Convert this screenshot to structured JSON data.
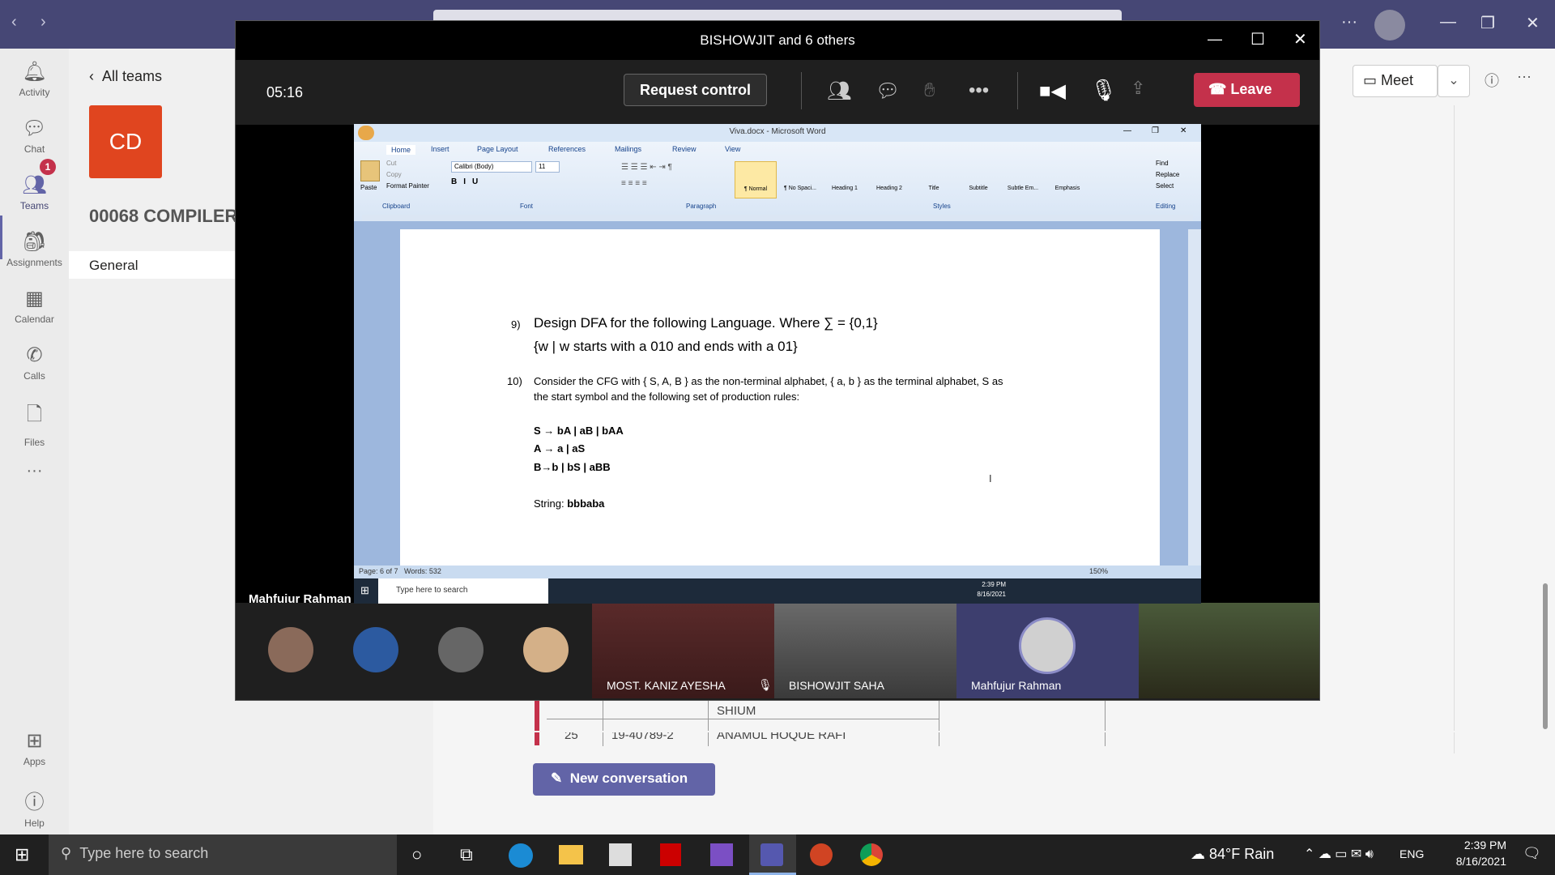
{
  "meeting": {
    "title": "BISHOWJIT and 6 others",
    "timer": "05:16",
    "request_control": "Request control",
    "leave": "Leave",
    "presenter_label": "Mahfujur Rahman",
    "participants": [
      {
        "name": "MOST. KANIZ AYESHA",
        "muted": true
      },
      {
        "name": "BISHOWJIT SAHA"
      },
      {
        "name": "Mahfujur Rahman"
      }
    ]
  },
  "teams": {
    "rail": [
      {
        "label": "Activity",
        "icon": "bell-icon"
      },
      {
        "label": "Chat",
        "icon": "chat-icon",
        "badge": "1"
      },
      {
        "label": "Teams",
        "icon": "teams-icon"
      },
      {
        "label": "Assignments",
        "icon": "assignments-icon"
      },
      {
        "label": "Calendar",
        "icon": "calendar-icon"
      },
      {
        "label": "Calls",
        "icon": "phone-icon"
      },
      {
        "label": "Files",
        "icon": "file-icon"
      },
      {
        "label": "Apps",
        "icon": "apps-icon"
      },
      {
        "label": "Help",
        "icon": "help-icon"
      }
    ],
    "all_teams": "All teams",
    "team_avatar": "CD",
    "team_name": "00068 COMPILER",
    "channel": "General",
    "meet_button": "Meet",
    "new_conversation": "New conversation",
    "table_rows": [
      "SHIUM",
      "25",
      "19-40789-2",
      "ANAMUL HOQUE RAFI"
    ]
  },
  "word": {
    "title": "Viva.docx - Microsoft Word",
    "tabs": [
      "Home",
      "Insert",
      "Page Layout",
      "References",
      "Mailings",
      "Review",
      "View"
    ],
    "font": "Calibri (Body)",
    "font_size": "11",
    "styles": [
      "¶ Normal",
      "¶ No Spaci...",
      "Heading 1",
      "Heading 2",
      "Title",
      "Subtitle",
      "Subtle Em...",
      "Emphasis"
    ],
    "groups": [
      "Clipboard",
      "Font",
      "Paragraph",
      "Styles",
      "Editing"
    ],
    "editing": [
      "Find",
      "Replace",
      "Select"
    ],
    "clipboard": [
      "Paste",
      "Cut",
      "Copy",
      "Format Painter"
    ],
    "status_page": "Page: 6 of 7",
    "status_words": "Words: 532",
    "zoom": "150%",
    "q9_num": "9)",
    "q9_line1": "Design DFA for the following Language. Where ∑ = {0,1}",
    "q9_line2": "{w | w starts with a 010 and ends with a 01}",
    "q10_num": "10)",
    "q10_line1": "Consider the CFG with { S, A, B } as the non-terminal alphabet, { a, b } as the terminal alphabet, S as",
    "q10_line2": "the start symbol and the following set of production rules:",
    "rule1": "S → bA | aB | bAA",
    "rule2": "A → a | aS",
    "rule3": "B→b | bS | aBB",
    "string_label": "String: ",
    "string_value": "bbbaba"
  },
  "inner_taskbar": {
    "search": "Type here to search",
    "time": "2:39 PM",
    "date": "8/16/2021"
  },
  "taskbar": {
    "search": "Type here to search",
    "weather": "84°F  Rain",
    "lang": "ENG",
    "time": "2:39 PM",
    "date": "8/16/2021"
  }
}
